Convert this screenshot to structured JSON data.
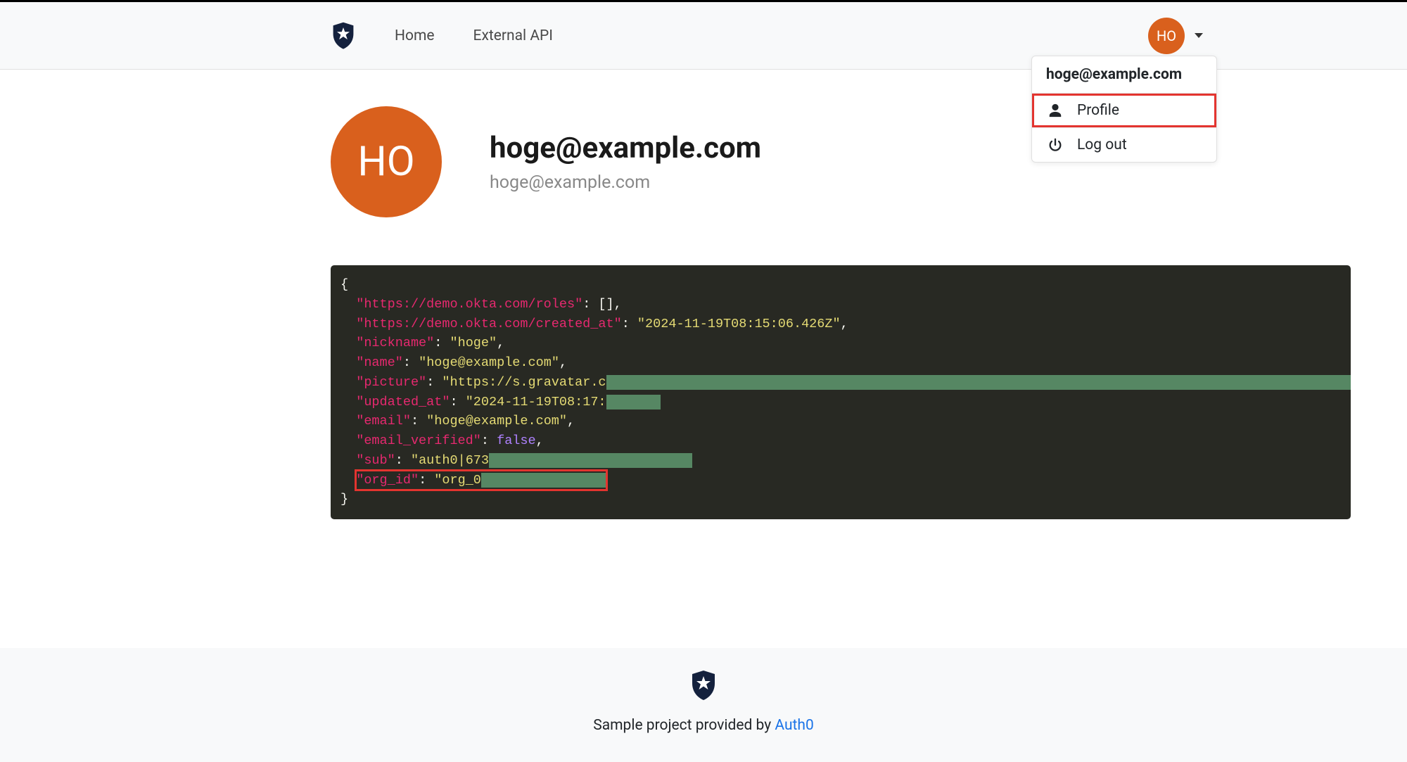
{
  "nav": {
    "home_label": "Home",
    "external_api_label": "External API",
    "avatar_initials": "HO"
  },
  "dropdown": {
    "header_email": "hoge@example.com",
    "profile_label": "Profile",
    "logout_label": "Log out"
  },
  "profile": {
    "avatar_initials": "HO",
    "title": "hoge@example.com",
    "subtitle": "hoge@example.com"
  },
  "json_dump": {
    "keys": {
      "roles": "https://demo.okta.com/roles",
      "created_at": "https://demo.okta.com/created_at",
      "nickname": "nickname",
      "name": "name",
      "picture": "picture",
      "updated_at": "updated_at",
      "email": "email",
      "email_verified": "email_verified",
      "sub": "sub",
      "org_id": "org_id"
    },
    "values": {
      "roles": "[]",
      "created_at": "2024-11-19T08:15:06.426Z",
      "nickname": "hoge",
      "name": "hoge@example.com",
      "picture_visible_prefix": "https://s.gravatar.c",
      "updated_at_visible_prefix": "2024-11-19T08:17:",
      "email": "hoge@example.com",
      "email_verified": "false",
      "sub_visible_prefix": "auth0|673",
      "org_id_visible_prefix": "org_0"
    }
  },
  "footer": {
    "text_prefix": "Sample project provided by ",
    "link_label": "Auth0"
  }
}
